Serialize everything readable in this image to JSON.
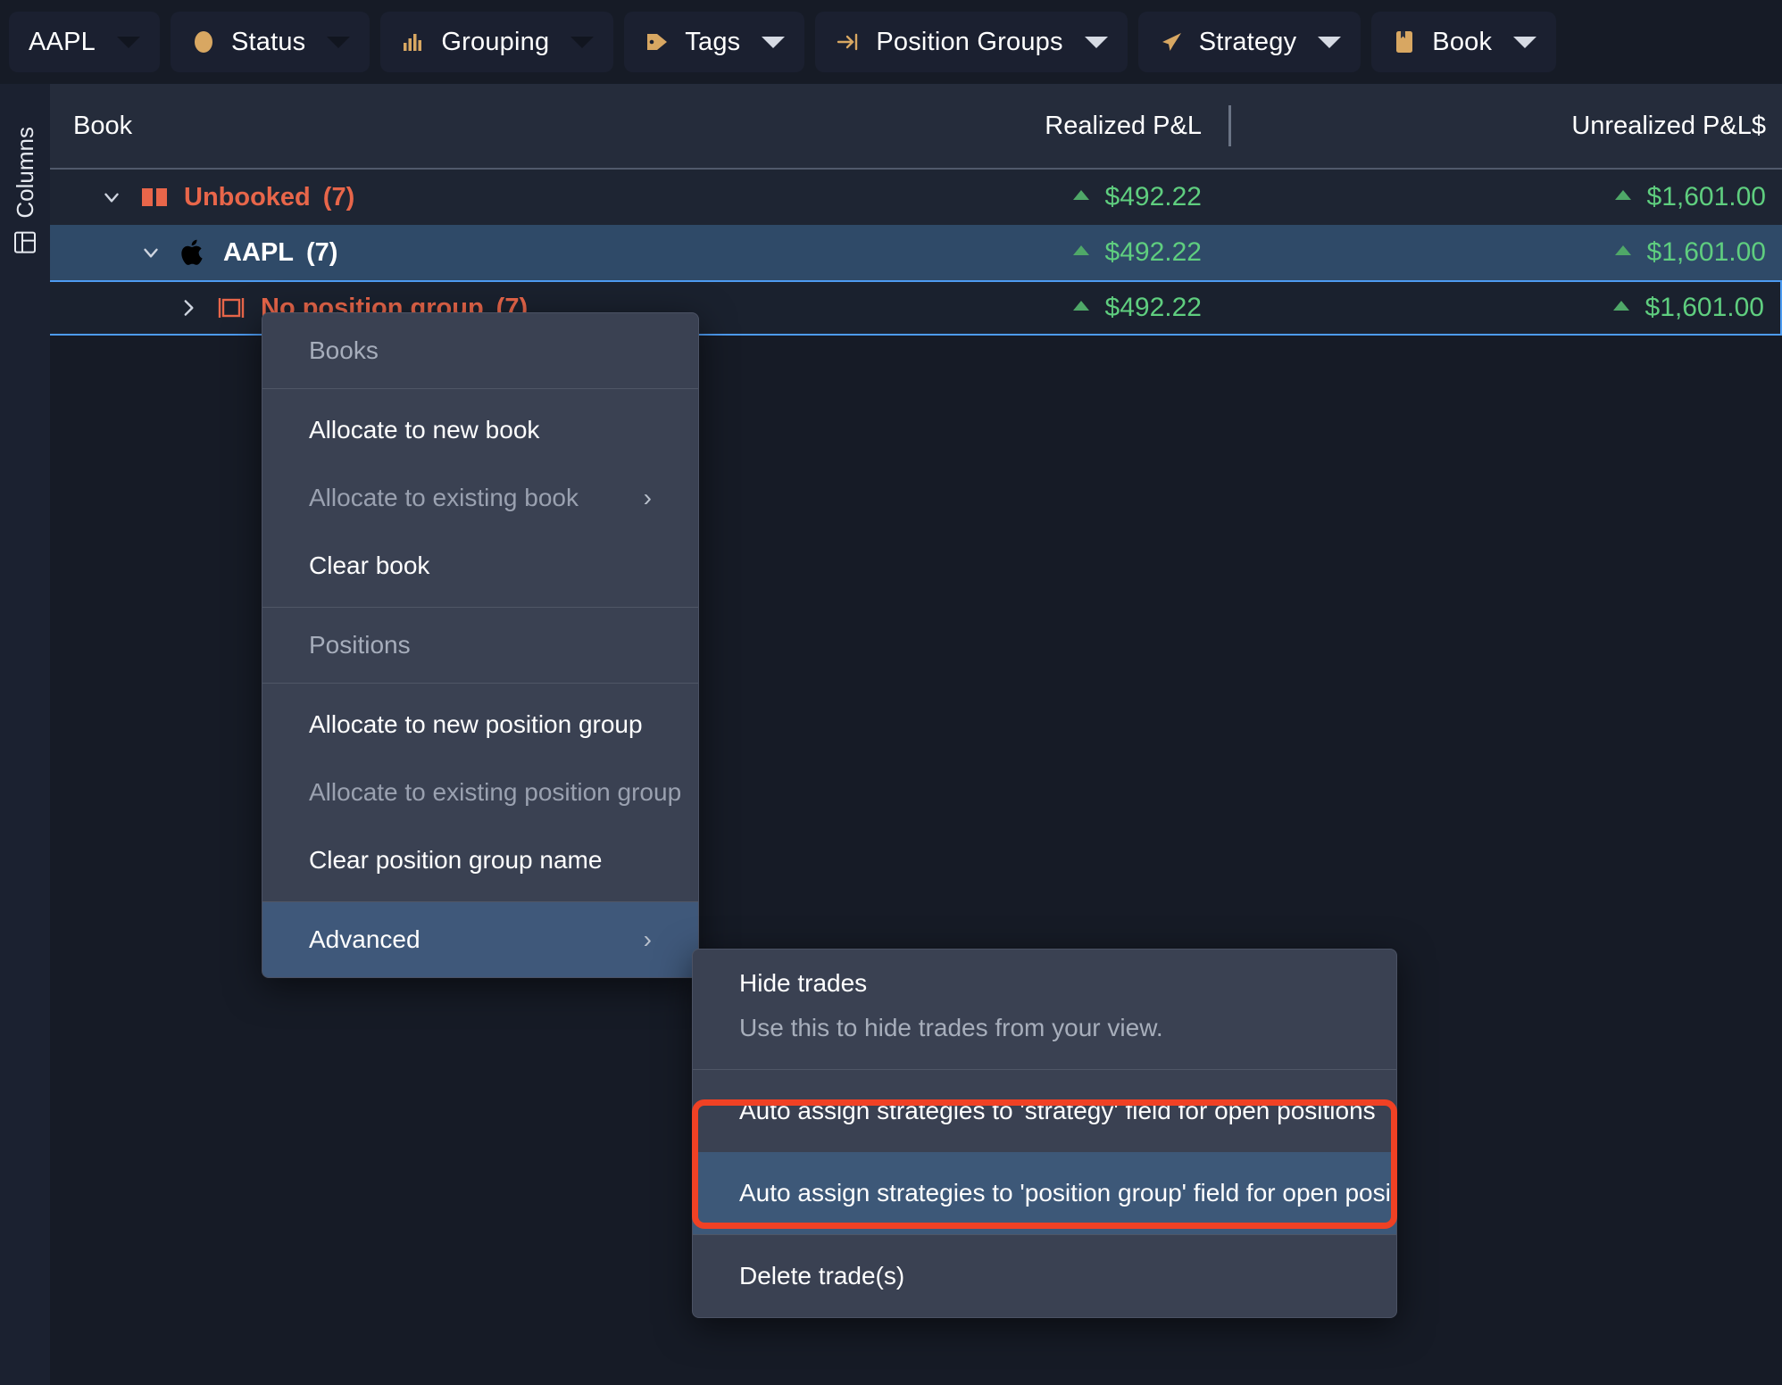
{
  "toolbar": {
    "items": [
      {
        "label": "AAPL",
        "icon": "",
        "caret": "chevron-down-icon",
        "caret_style": "dark"
      },
      {
        "label": "Status",
        "icon": "status-dot-icon",
        "caret": "chevron-down-icon",
        "caret_style": "dark"
      },
      {
        "label": "Grouping",
        "icon": "bar-chart-icon",
        "caret": "chevron-down-icon",
        "caret_style": "dark"
      },
      {
        "label": "Tags",
        "icon": "tag-icon",
        "caret": "chevron-down-icon",
        "caret_style": "light"
      },
      {
        "label": "Position Groups",
        "icon": "position-group-icon",
        "caret": "chevron-down-icon",
        "caret_style": "light"
      },
      {
        "label": "Strategy",
        "icon": "paper-plane-icon",
        "caret": "chevron-down-icon",
        "caret_style": "light"
      },
      {
        "label": "Book",
        "icon": "book-icon",
        "caret": "chevron-down-icon",
        "caret_style": "light"
      }
    ]
  },
  "left_rail": {
    "columns_label": "Columns",
    "icon": "columns-panel-icon"
  },
  "grid": {
    "headers": {
      "book": "Book",
      "realized": "Realized P&L",
      "unrealized": "Unrealized P&L$"
    },
    "rows": [
      {
        "level": 0,
        "twisty": "chevron-down-icon",
        "icon": "open-book-icon",
        "label": "Unbooked",
        "count": "(7)",
        "realized": "$492.22",
        "unrealized": "$1,601.00",
        "trend": "up",
        "color": "red",
        "selected": false
      },
      {
        "level": 1,
        "twisty": "chevron-down-icon",
        "icon": "apple-logo-icon",
        "label": "AAPL",
        "count": "(7)",
        "realized": "$492.22",
        "unrealized": "$1,601.00",
        "trend": "up",
        "color": "white",
        "selected": true
      },
      {
        "level": 2,
        "twisty": "chevron-right-icon",
        "icon": "position-group-box-icon",
        "label": "No position group",
        "count": "(7)",
        "realized": "$492.22",
        "unrealized": "$1,601.00",
        "trend": "up",
        "color": "red",
        "selected": false
      }
    ]
  },
  "context_menu": {
    "section_books_label": "Books",
    "items_books": [
      {
        "label": "Allocate to new book",
        "disabled": false,
        "submenu": false
      },
      {
        "label": "Allocate to existing book",
        "disabled": true,
        "submenu": true
      },
      {
        "label": "Clear book",
        "disabled": false,
        "submenu": false
      }
    ],
    "section_positions_label": "Positions",
    "items_positions": [
      {
        "label": "Allocate to new position group",
        "disabled": false,
        "submenu": false
      },
      {
        "label": "Allocate to existing position group",
        "disabled": true,
        "submenu": true
      },
      {
        "label": "Clear position group name",
        "disabled": false,
        "submenu": false
      }
    ],
    "advanced": {
      "label": "Advanced",
      "submenu": true,
      "highlighted": true
    }
  },
  "submenu": {
    "hide_trades": {
      "label": "Hide trades",
      "description": "Use this to hide trades from your view."
    },
    "auto_assign_strategy": "Auto assign strategies to 'strategy' field for open positions",
    "auto_assign_position_group": "Auto assign strategies to 'position group' field for open positions",
    "delete_trades": "Delete trade(s)"
  },
  "colors": {
    "accent_orange": "#d8a762",
    "annotation_red": "#f04124",
    "positive_green": "#5fce7f",
    "row_red": "#e8664a",
    "selected_row": "#2f4a68",
    "focus_blue": "#4d9bf0"
  }
}
